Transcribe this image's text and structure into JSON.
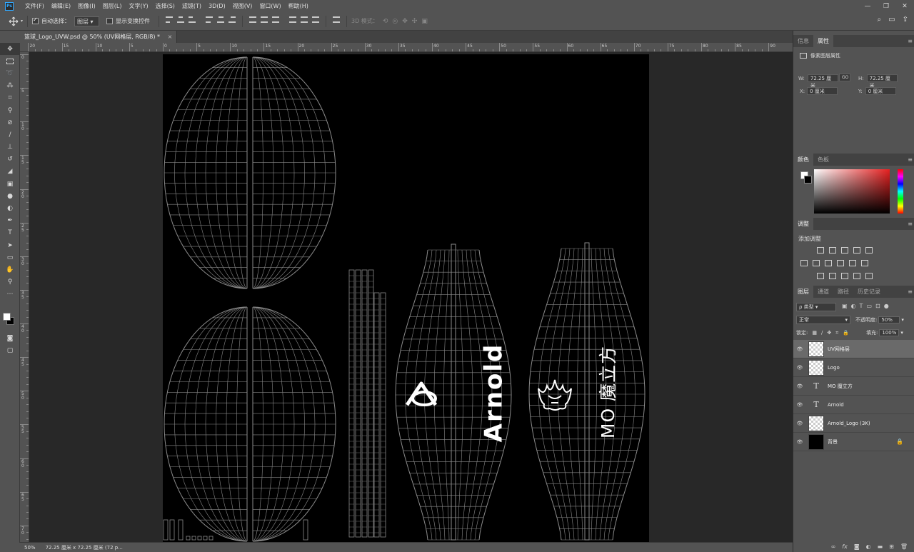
{
  "app": {
    "logo": "Ps"
  },
  "menubar": {
    "items": [
      "文件(F)",
      "编辑(E)",
      "图像(I)",
      "图层(L)",
      "文字(Y)",
      "选择(S)",
      "滤镜(T)",
      "3D(D)",
      "视图(V)",
      "窗口(W)",
      "帮助(H)"
    ],
    "window_controls": [
      "—",
      "❐",
      "✕"
    ]
  },
  "options": {
    "auto_select_label": "自动选择：",
    "auto_select_target": "图层",
    "show_transform_label": "显示变换控件",
    "mode_3d_label": "3D 模式："
  },
  "document": {
    "tab_title": "篮球_Logo_UVW.psd @ 50% (UV网格层, RGB/8) *",
    "close": "×"
  },
  "rulers": {
    "top_labels": [
      "20",
      "15",
      "10",
      "5",
      "0",
      "5",
      "10",
      "15",
      "20",
      "25",
      "30",
      "35",
      "40",
      "45",
      "50",
      "55",
      "60",
      "65",
      "70",
      "75",
      "80",
      "85",
      "90"
    ],
    "left_labels": [
      "0",
      "5",
      "1 0",
      "1 5",
      "2 0",
      "2 5",
      "3 0",
      "3 5",
      "4 0",
      "4 5",
      "5 0",
      "5 5",
      "6 0",
      "6 5",
      "7 0"
    ]
  },
  "canvas": {
    "text_arnold": "Arnold",
    "text_mo": "MO 魔立方"
  },
  "status": {
    "zoom": "50%",
    "doc_info": "72.25 厘米 x 72.25 厘米 (72 p..."
  },
  "properties_panel": {
    "tabs": [
      "信息",
      "属性"
    ],
    "active_tab": 1,
    "header": "像素图层属性",
    "w_label": "W:",
    "w_value": "72.25 厘米",
    "h_label": "H:",
    "h_value": "72.25 厘米",
    "x_label": "X:",
    "x_value": "0 厘米",
    "y_label": "Y:",
    "y_value": "0 厘米",
    "link_label": "GO"
  },
  "color_panel": {
    "tabs": [
      "颜色",
      "色板"
    ],
    "active_tab": 0,
    "hue_color": "#e62020"
  },
  "adjustments_panel": {
    "tabs": [
      "调整"
    ],
    "header": "添加调整"
  },
  "layers_panel": {
    "tabs": [
      "图层",
      "通道",
      "路径",
      "历史记录"
    ],
    "active_tab": 0,
    "filter_label": "ρ 类型",
    "blend_mode": "正常",
    "opacity_label": "不透明度:",
    "opacity_value": "50%",
    "lock_label": "锁定:",
    "fill_label": "填充:",
    "fill_value": "100%",
    "layers": [
      {
        "name": "UV网格层",
        "kind": "pixel",
        "selected": true
      },
      {
        "name": "Logo",
        "kind": "pixel",
        "selected": false
      },
      {
        "name": "MO 魔立方",
        "kind": "text",
        "selected": false
      },
      {
        "name": "Arnold",
        "kind": "text",
        "selected": false
      },
      {
        "name": "Arnold_Logo (3K)",
        "kind": "pixel",
        "selected": false
      },
      {
        "name": "背景",
        "kind": "background",
        "selected": false,
        "locked": true
      }
    ],
    "bottom_icons": [
      "link-icon",
      "fx-icon",
      "mask-icon",
      "adjustment-icon",
      "folder-icon",
      "new-layer-icon",
      "trash-icon"
    ]
  },
  "colors": {
    "ui_bg": "#535353",
    "ui_dark": "#424242",
    "workspace": "#282828",
    "canvas": "#000000",
    "accent": "#31a8ff"
  }
}
